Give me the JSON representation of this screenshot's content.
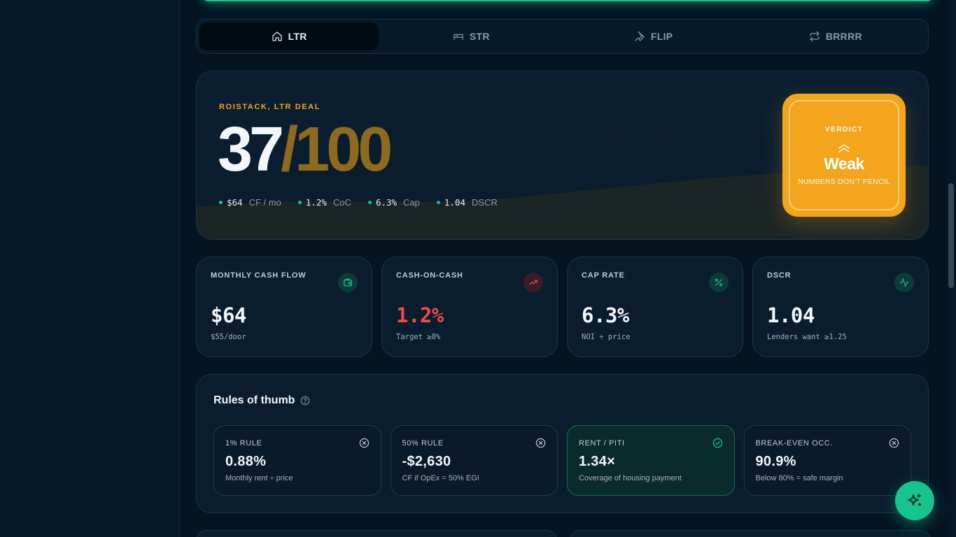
{
  "tabs": [
    {
      "label": "LTR",
      "icon": "home-icon",
      "active": true
    },
    {
      "label": "STR",
      "icon": "bed-icon",
      "active": false
    },
    {
      "label": "FLIP",
      "icon": "wrench-icon",
      "active": false
    },
    {
      "label": "BRRRR",
      "icon": "repeat-icon",
      "active": false
    }
  ],
  "hero": {
    "eyebrow": "ROISTACK, LTR DEAL",
    "score": "37",
    "score_max": "/100",
    "metrics": [
      {
        "value": "$64",
        "label": "CF / mo",
        "color": "#17c48f"
      },
      {
        "value": "1.2%",
        "label": "CoC",
        "color": "#17c48f"
      },
      {
        "value": "6.3%",
        "label": "Cap",
        "color": "#17c48f"
      },
      {
        "value": "1.04",
        "label": "DSCR",
        "color": "#1fa2e0"
      }
    ]
  },
  "verdict": {
    "label": "VERDICT",
    "word": "Weak",
    "sub": "NUMBERS DON'T PENCIL",
    "color": "#f2a51d",
    "icon": "chevrons-up-icon"
  },
  "cards": [
    {
      "label": "MONTHLY CASH FLOW",
      "value": "$64",
      "sub": "$55/door",
      "value_color": "#f2f6f9",
      "icon": "wallet-icon",
      "icon_color": "#17c48f",
      "icon_bg": "#0f3a3a"
    },
    {
      "label": "CASH-ON-CASH",
      "value": "1.2%",
      "sub": "Target ≥8%",
      "value_color": "#f04a4a",
      "icon": "trending-up-icon",
      "icon_color": "#f04a4a",
      "icon_bg": "#3a1c28"
    },
    {
      "label": "CAP RATE",
      "value": "6.3%",
      "sub": "NOI ÷ price",
      "value_color": "#f2f6f9",
      "icon": "percent-icon",
      "icon_color": "#17c48f",
      "icon_bg": "#0f3a3a"
    },
    {
      "label": "DSCR",
      "value": "1.04",
      "sub": "Lenders want ≥1.25",
      "value_color": "#f2f6f9",
      "icon": "activity-icon",
      "icon_color": "#17c48f",
      "icon_bg": "#0f3a3a"
    }
  ],
  "rules": {
    "title": "Rules of thumb",
    "items": [
      {
        "label": "1% RULE",
        "value": "0.88%",
        "sub": "Monthly rent ÷ price",
        "status": "fail"
      },
      {
        "label": "50% RULE",
        "value": "-$2,630",
        "sub": "CF if OpEx = 50% EGI",
        "status": "fail"
      },
      {
        "label": "RENT / PITI",
        "value": "1.34×",
        "sub": "Coverage of housing payment",
        "status": "pass"
      },
      {
        "label": "BREAK-EVEN OCC.",
        "value": "90.9%",
        "sub": "Below 80% = safe margin",
        "status": "fail"
      }
    ]
  }
}
